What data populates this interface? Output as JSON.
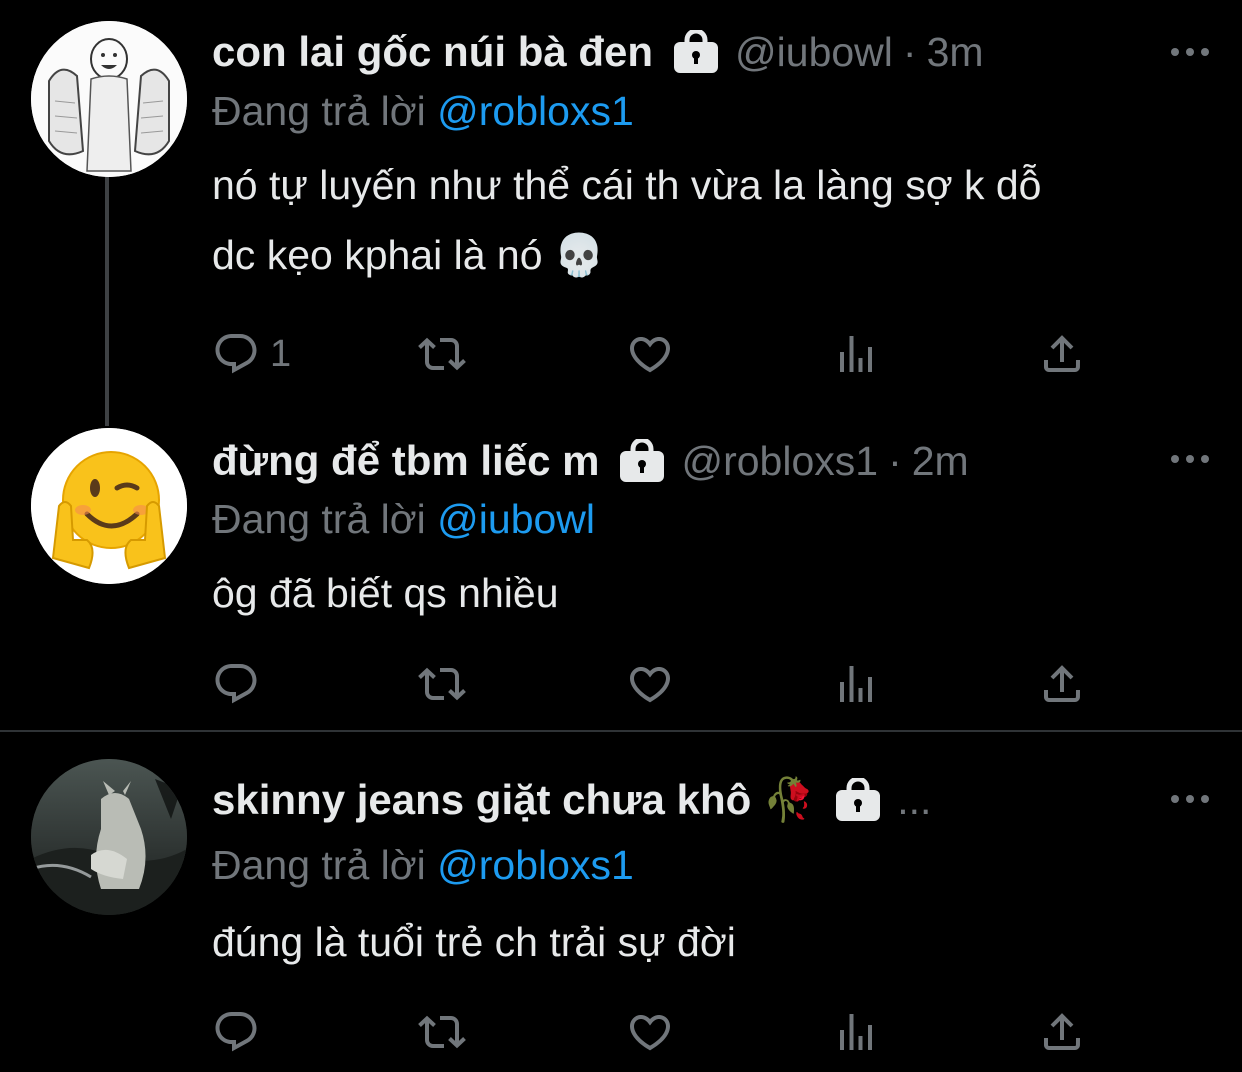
{
  "tweets": [
    {
      "name": "con lai gốc núi bà đen",
      "handle": "@iubowl",
      "separator": "·",
      "time": "3m",
      "replying_prefix": "Đang trả lời",
      "replying_to": "@robloxs1",
      "body_line1": "nó tự luyến như thể cái th vừa la làng sợ k dỗ",
      "body_line2": "dc kẹo kphai là nó 💀",
      "reply_count": "1",
      "avatar": "thumbs-up-sketch-avatar"
    },
    {
      "name": "đừng để tbm liếc m",
      "handle": "@robloxs1",
      "separator": "·",
      "time": "2m",
      "replying_prefix": "Đang trả lời",
      "replying_to": "@iubowl",
      "body_line1": "ôg đã biết qs nhiều",
      "reply_count": "",
      "avatar": "winking-emoji-avatar"
    },
    {
      "name": "skinny jeans giặt chưa khô 🥀",
      "handle": "...",
      "replying_prefix": "Đang trả lời",
      "replying_to": "@robloxs1",
      "body_line1": "đúng là tuổi trẻ ch trải sự đời",
      "reply_count": "",
      "avatar": "werewolf-art-avatar"
    }
  ],
  "colors": {
    "background": "#000000",
    "text": "#e7e9ea",
    "secondary": "#71767b",
    "link": "#1d9bf0",
    "divider": "#2f3336"
  },
  "icons": [
    "reply-icon",
    "retweet-icon",
    "like-icon",
    "views-icon",
    "share-icon",
    "lock-icon",
    "more-icon"
  ]
}
